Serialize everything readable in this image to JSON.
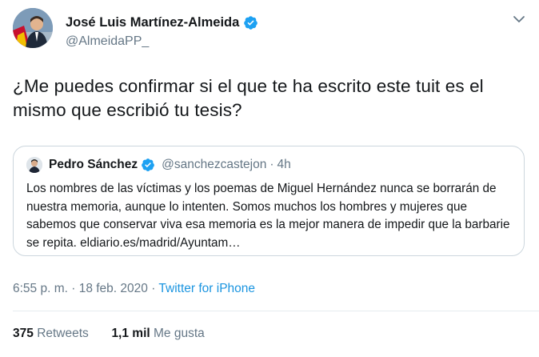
{
  "author": {
    "name": "José Luis Martínez-Almeida",
    "handle": "@AlmeidaPP_"
  },
  "tweet": {
    "text": "¿Me puedes confirmar si el que te ha escrito este tuit es el mismo que escribió tu tesis?"
  },
  "quoted_tweet": {
    "name": "Pedro Sánchez",
    "handle": "@sanchezcastejon",
    "separator": "·",
    "time": "4h",
    "text": "Los nombres de las víctimas y los poemas de Miguel Hernández nunca se borrarán de nuestra memoria, aunque lo intenten. Somos muchos los hombres y mujeres que sabemos que conservar viva esa memoria es la mejor manera de impedir que la barbarie se repita. eldiario.es/madrid/Ayuntam…"
  },
  "meta": {
    "timestamp": "6:55 p. m. · 18 feb. 2020",
    "separator": "·",
    "source": "Twitter for iPhone"
  },
  "stats": {
    "retweets_count": "375",
    "retweets_label": "Retweets",
    "likes_count": "1,1 mil",
    "likes_label": "Me gusta"
  },
  "colors": {
    "verified": "#1da1f2",
    "link": "#1b95e0",
    "secondary_text": "#657786",
    "border": "#ccd6dd"
  },
  "icons": {
    "verified": "verified-badge-icon",
    "menu": "chevron-down-icon"
  }
}
